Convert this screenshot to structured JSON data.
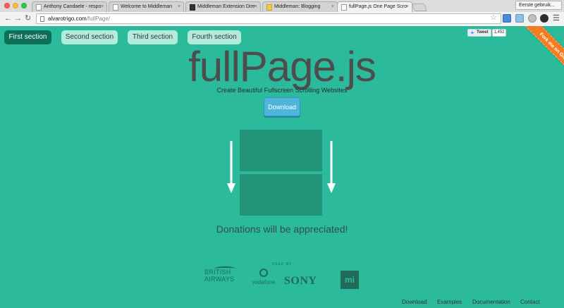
{
  "browser": {
    "tabs": [
      {
        "label": "Anthony Candaele - respo",
        "favicon": "page",
        "active": false
      },
      {
        "label": "Welcome to Middleman",
        "favicon": "page",
        "active": false
      },
      {
        "label": "Middleman Extension Dire",
        "favicon": "mm",
        "active": false
      },
      {
        "label": "Middleman: Blogging",
        "favicon": "blog",
        "active": false
      },
      {
        "label": "fullPage.js One Page Scro",
        "favicon": "page",
        "active": true
      }
    ],
    "profile_label": "Eerste gebruik...",
    "url_domain": "alvarotrigo.com",
    "url_path": "/fullPage/"
  },
  "page_nav": {
    "items": [
      {
        "label": "First section",
        "active": true
      },
      {
        "label": "Second section",
        "active": false
      },
      {
        "label": "Third section",
        "active": false
      },
      {
        "label": "Fourth section",
        "active": false
      }
    ]
  },
  "social": {
    "tweet_label": "Tweet",
    "tweet_count": "1,452"
  },
  "ribbon": {
    "label": "Fork me on GitHub"
  },
  "hero": {
    "title": "fullPage.js",
    "subtitle": "Create Beautiful Fullscreen Scrolling Websites",
    "download_label": "Download"
  },
  "donation": {
    "text": "Donations will be appreciated!"
  },
  "used_by": {
    "label": "USED BY",
    "logos": {
      "british_airways": [
        "BRITISH",
        "AIRWAYS"
      ],
      "vodafone": "vodafone",
      "sony": "SONY",
      "mi": "mi"
    }
  },
  "footer": {
    "links": [
      "Download",
      "Examples",
      "Documentation",
      "Contact"
    ]
  },
  "colors": {
    "background": "#2bbb9c",
    "nav_active": "#0e6f58",
    "nav_inactive": "#b2ecdb",
    "download": "#4fb5da",
    "ribbon": "#f47b20"
  }
}
